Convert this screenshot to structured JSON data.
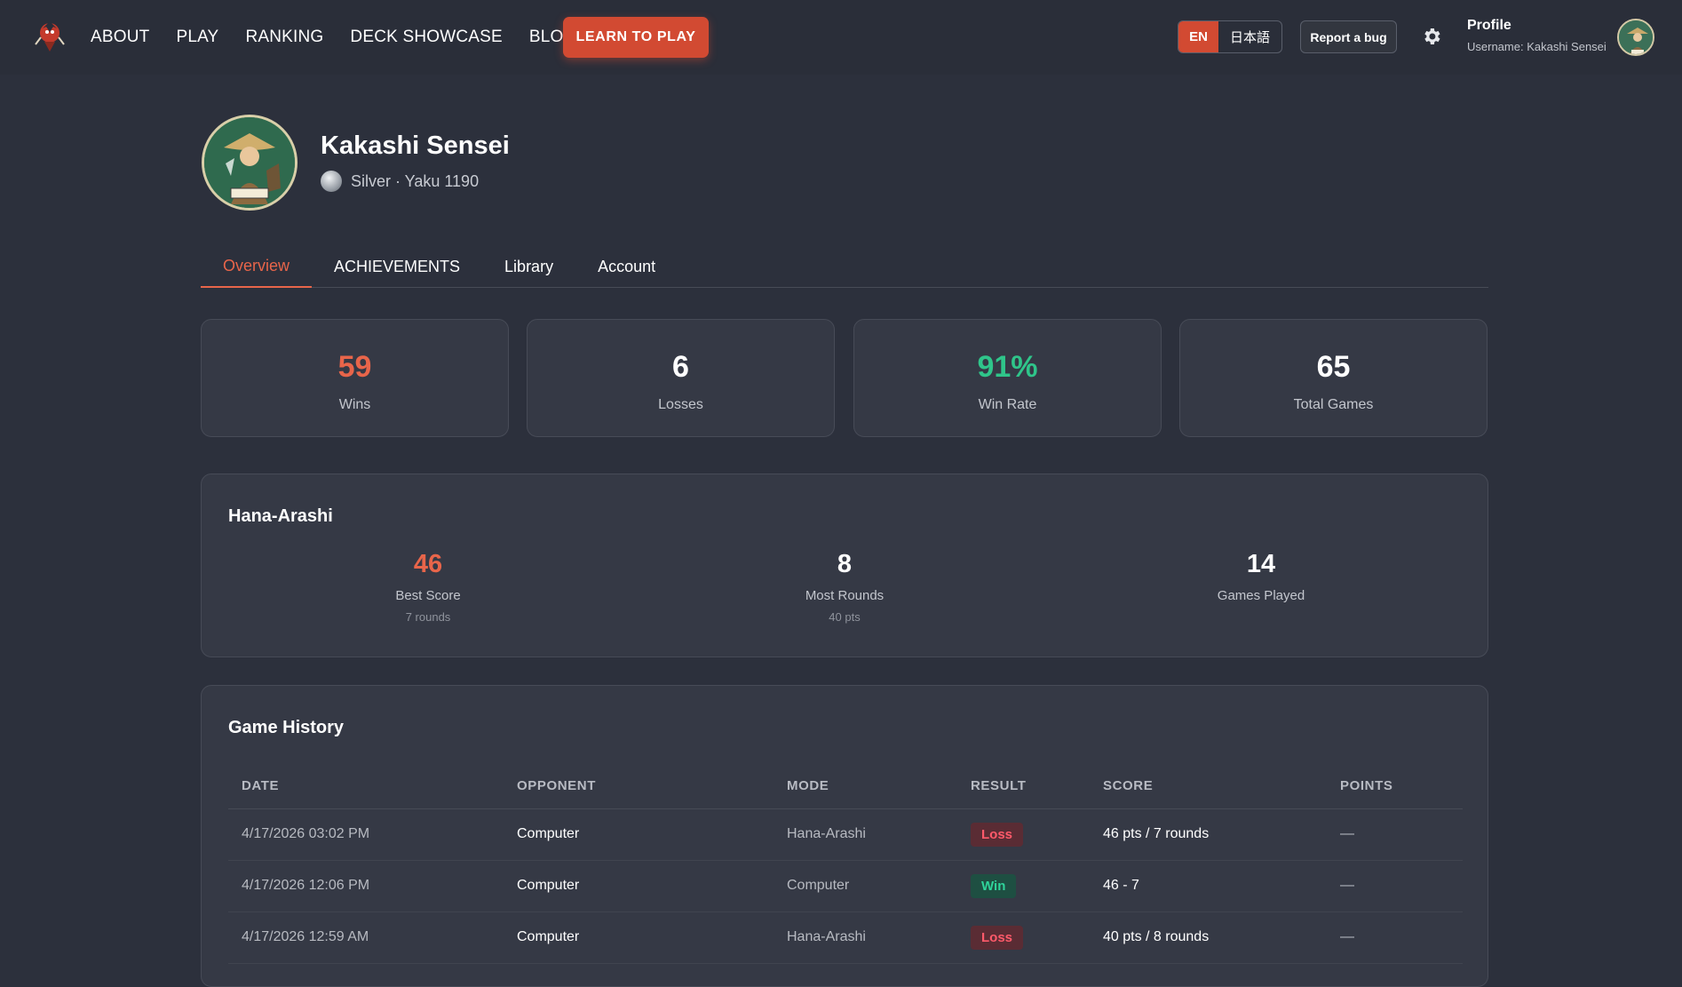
{
  "nav": {
    "items": [
      "ABOUT",
      "PLAY",
      "RANKING",
      "DECK SHOWCASE",
      "BLOG"
    ],
    "learn_label": "LEARN TO PLAY",
    "lang_en": "EN",
    "lang_ja": "日本語",
    "bug_label": "Report a bug",
    "profile_title": "Profile",
    "profile_username": "Username: Kakashi Sensei"
  },
  "player": {
    "name": "Kakashi Sensei",
    "rank": "Silver · Yaku 1190"
  },
  "tabs": [
    {
      "label": "Overview",
      "active": true
    },
    {
      "label": "ACHIEVEMENTS",
      "active": false
    },
    {
      "label": "Library",
      "active": false
    },
    {
      "label": "Account",
      "active": false
    }
  ],
  "stats": [
    {
      "value": "59",
      "label": "Wins",
      "color": "#e8654a"
    },
    {
      "value": "6",
      "label": "Losses",
      "color": "#ffffff"
    },
    {
      "value": "91%",
      "label": "Win Rate",
      "color": "#2fc58a"
    },
    {
      "value": "65",
      "label": "Total Games",
      "color": "#ffffff"
    }
  ],
  "hana": {
    "title": "Hana-Arashi",
    "items": [
      {
        "value": "46",
        "label": "Best Score",
        "sub": "7 rounds"
      },
      {
        "value": "8",
        "label": "Most Rounds",
        "sub": "40 pts"
      },
      {
        "value": "14",
        "label": "Games Played",
        "sub": ""
      }
    ]
  },
  "history": {
    "title": "Game History",
    "columns": [
      "DATE",
      "OPPONENT",
      "MODE",
      "RESULT",
      "SCORE",
      "POINTS"
    ],
    "rows": [
      {
        "date": "4/17/2026 03:02 PM",
        "opponent": "Computer",
        "mode": "Hana-Arashi",
        "result": "Loss",
        "score": "46 pts / 7 rounds",
        "points": "—"
      },
      {
        "date": "4/17/2026 12:06 PM",
        "opponent": "Computer",
        "mode": "Computer",
        "result": "Win",
        "score": "46 - 7",
        "points": "—"
      },
      {
        "date": "4/17/2026 12:59 AM",
        "opponent": "Computer",
        "mode": "Hana-Arashi",
        "result": "Loss",
        "score": "40 pts / 8 rounds",
        "points": "—"
      }
    ]
  }
}
